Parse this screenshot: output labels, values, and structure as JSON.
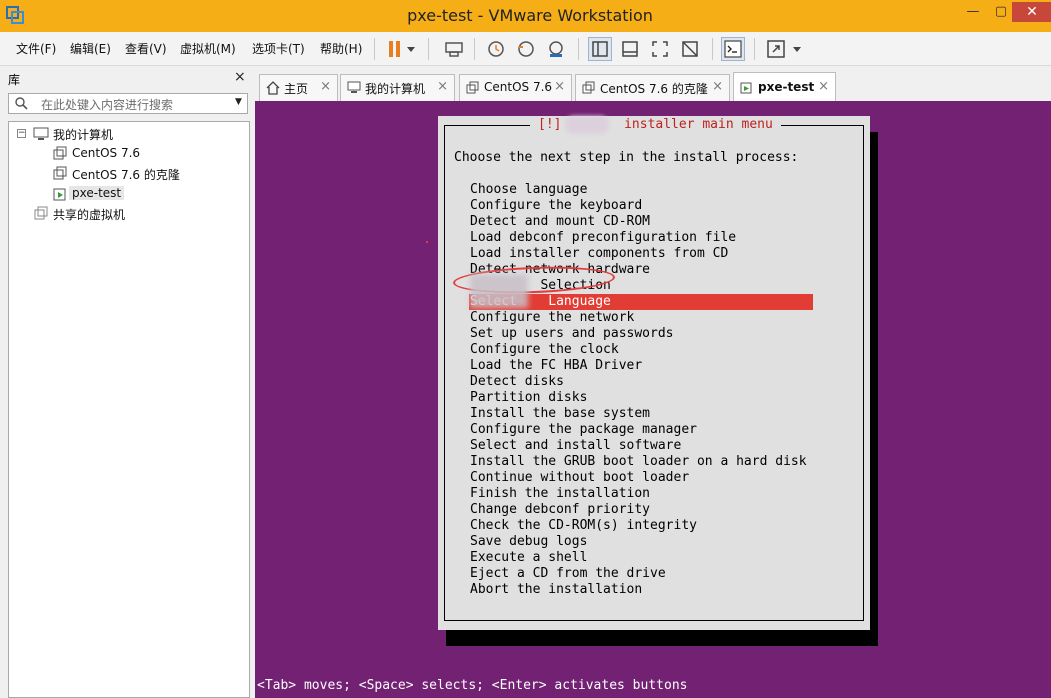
{
  "window": {
    "title": "pxe-test - VMware Workstation",
    "icon": "vmware-logo-icon",
    "minimize": "—",
    "maximize": "▢",
    "close": "✕"
  },
  "menu": {
    "file": "文件(F)",
    "edit": "编辑(E)",
    "view": "查看(V)",
    "vm": "虚拟机(M)",
    "tabs": "选项卡(T)",
    "help": "帮助(H)"
  },
  "toolbar": {
    "icons": [
      "pause-icon",
      "dropdown-icon",
      "send-ctrl-alt-del-icon",
      "snapshot-icon",
      "revert-snapshot-icon",
      "snapshot-manager-icon",
      "library-view-icon",
      "thumbnail-bar-icon",
      "fullscreen-icon",
      "unity-icon",
      "console-icon",
      "stretch-icon",
      "dropdown-icon"
    ],
    "accent": "#e67e22"
  },
  "library": {
    "title": "库",
    "close": "×",
    "search_placeholder": "在此处键入内容进行搜索",
    "tree": {
      "root": "我的计算机",
      "items": [
        "CentOS 7.6",
        "CentOS 7.6 的克隆",
        "pxe-test"
      ],
      "selected": "pxe-test",
      "shared": "共享的虚拟机"
    }
  },
  "tabs": [
    {
      "label": "主页",
      "icon": "home-icon"
    },
    {
      "label": "我的计算机",
      "icon": "computer-icon"
    },
    {
      "label": "CentOS 7.6",
      "icon": "vm-icon"
    },
    {
      "label": "CentOS 7.6 的克隆",
      "icon": "vm-clone-icon"
    },
    {
      "label": "pxe-test",
      "icon": "vm-running-icon",
      "active": true
    }
  ],
  "tab_close": "×",
  "console": {
    "background": "#732173",
    "dialog_title": "[!]        installer main menu",
    "prompt": "Choose the next step in the install process:",
    "menu_items": [
      "Choose language",
      "Configure the keyboard",
      "Detect and mount CD-ROM",
      "Load debconf preconfiguration file",
      "Load installer components from CD",
      "Detect network hardware",
      "         Selection",
      "Select    Language",
      "Configure the network",
      "Set up users and passwords",
      "Configure the clock",
      "Load the FC HBA Driver",
      "Detect disks",
      "Partition disks",
      "Install the base system",
      "Configure the package manager",
      "Select and install software",
      "Install the GRUB boot loader on a hard disk",
      "Continue without boot loader",
      "Finish the installation",
      "Change debconf priority",
      "Check the CD-ROM(s) integrity",
      "Save debug logs",
      "Execute a shell",
      "Eject a CD from the drive",
      "Abort the installation"
    ],
    "selected_index": 7,
    "highlight_color": "#e23d34",
    "status_line": "<Tab> moves; <Space> selects; <Enter> activates buttons"
  }
}
